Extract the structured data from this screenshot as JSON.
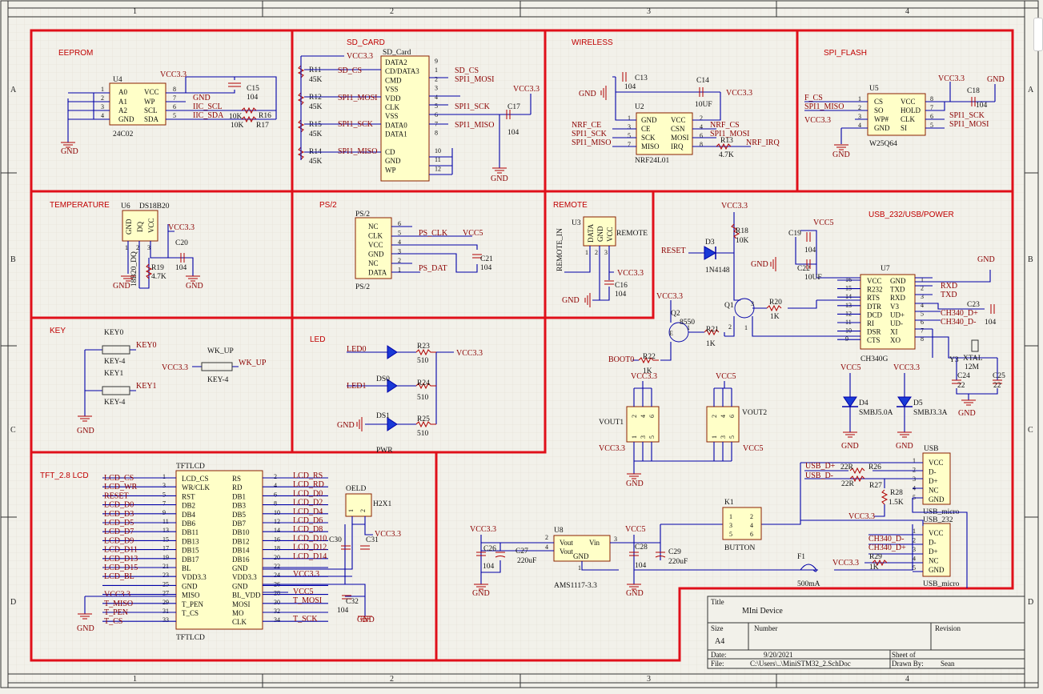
{
  "zones": {
    "columns": [
      "1",
      "2",
      "3",
      "4"
    ],
    "rows": [
      "A",
      "B",
      "C",
      "D"
    ]
  },
  "sections": [
    "EEPROM",
    "SD_CARD",
    "WIRELESS",
    "SPI_FLASH",
    "TEMPERATURE",
    "PS/2",
    "REMOTE",
    "USB_232/USB/POWER",
    "KEY",
    "LED",
    "TFT_2.8 LCD"
  ],
  "eeprom": {
    "ref": "U4",
    "part": "24C02",
    "left_pins": [
      "A0",
      "A1",
      "A2",
      "GND"
    ],
    "left_nums": [
      "1",
      "2",
      "3",
      "4"
    ],
    "right_pins": [
      "VCC",
      "WP",
      "SCL",
      "SDA"
    ],
    "right_nums": [
      "8",
      "7",
      "6",
      "5"
    ],
    "nets": {
      "vcc": "VCC3.3",
      "gnd_wp": "GND",
      "scl": "IIC_SCL",
      "sda": "IIC_SDA",
      "gnd": "GND"
    },
    "c15": {
      "ref": "C15",
      "val": "104"
    },
    "r16": {
      "ref": "R16",
      "val": "10K"
    },
    "r17": {
      "ref": "R17",
      "val": "10K"
    }
  },
  "sdcard": {
    "ref": "SD_Card",
    "pins": [
      "DATA2",
      "CD/DATA3",
      "CMD",
      "VSS",
      "VDD",
      "CLK",
      "VSS",
      "DATA0",
      "DATA1",
      "",
      "CD",
      "GND",
      "WP"
    ],
    "nums": [
      "9",
      "1",
      "2",
      "3",
      "4",
      "5",
      "6",
      "7",
      "8",
      "",
      "10",
      "11",
      "12"
    ],
    "nets": {
      "vcc": "VCC3.3",
      "cs": "SD_CS",
      "mosi": "SPI1_MOSI",
      "sck": "SPI1_SCK",
      "miso": "SPI1_MISO",
      "gnd": "GND"
    },
    "left_nets": [
      "SD_CS",
      "SPI1_MOSI",
      "SPI1_SCK",
      "SPI1_MISO"
    ],
    "resistors": [
      {
        "ref": "R11",
        "val": "45K"
      },
      {
        "ref": "R12",
        "val": "45K"
      },
      {
        "ref": "R15",
        "val": "45K"
      },
      {
        "ref": "R14",
        "val": "45K"
      }
    ],
    "c17": {
      "ref": "C17",
      "val": "104"
    }
  },
  "wireless": {
    "ref": "U2",
    "part": "NRF24L01",
    "left_pins": [
      "GND",
      "CE",
      "SCK",
      "MISO"
    ],
    "left_nums": [
      "1",
      "3",
      "5",
      "7"
    ],
    "right_pins": [
      "VCC",
      "CSN",
      "MOSI",
      "IRQ"
    ],
    "right_nums": [
      "2",
      "4",
      "6",
      "8"
    ],
    "left_nets": [
      "NRF_CE",
      "SPI1_SCK",
      "SPI1_MISO"
    ],
    "right_nets": [
      "NRF_CS",
      "SPI1_MOSI",
      "NRF_IRQ"
    ],
    "gnd": "GND",
    "vcc": "VCC3.3",
    "c13": {
      "ref": "C13",
      "val": "104"
    },
    "c14": {
      "ref": "C14",
      "val": "10UF"
    },
    "r13": {
      "ref": "R13",
      "val": "4.7K"
    }
  },
  "spiflash": {
    "ref": "U5",
    "part": "W25Q64",
    "left_pins": [
      "CS",
      "SO",
      "WP#",
      "GND"
    ],
    "left_nums": [
      "1",
      "2",
      "3",
      "4"
    ],
    "right_pins": [
      "VCC",
      "HOLD",
      "CLK",
      "SI"
    ],
    "right_nums": [
      "8",
      "7",
      "6",
      "5"
    ],
    "left_nets": [
      "F_CS",
      "SPI1_MISO",
      "VCC3.3"
    ],
    "right_nets": [
      "SPI1_SCK",
      "SPI1_MOSI"
    ],
    "vcc": "VCC3.3",
    "gnd": "GND",
    "c18": {
      "ref": "C18",
      "val": "104"
    }
  },
  "temperature": {
    "ref": "U6",
    "part": "DS18B20",
    "pins": [
      "GND",
      "DQ",
      "VCC"
    ],
    "nums": [
      "1",
      "2",
      "3"
    ],
    "net": "18B20_DQ",
    "vcc": "VCC3.3",
    "gnd": "GND",
    "r19": {
      "ref": "R19",
      "val": "4.7K"
    },
    "c20": {
      "ref": "C20",
      "val": "104"
    }
  },
  "ps2": {
    "ref": "PS/2",
    "pins": [
      "NC",
      "CLK",
      "VCC",
      "GND",
      "NC",
      "DATA"
    ],
    "nums": [
      "6",
      "5",
      "4",
      "3",
      "2",
      "1"
    ],
    "nets": {
      "clk": "PS_CLK",
      "dat": "PS_DAT",
      "vcc": "VCC5"
    },
    "c21": {
      "ref": "C21",
      "val": "104"
    },
    "bottom_label": "PS/2"
  },
  "remote": {
    "ref": "U3",
    "pins": [
      "DATA",
      "GND",
      "VCC"
    ],
    "nums": [
      "1",
      "2",
      "3"
    ],
    "part": "REMOTE",
    "net": "REMOTE_IN",
    "vcc": "VCC3.3",
    "gnd": "GND",
    "c16": {
      "ref": "C16",
      "val": "104"
    }
  },
  "usb": {
    "ref": "U7",
    "part": "CH340G",
    "left_pins": [
      "VCC",
      "R232",
      "RTS",
      "DTR",
      "DCD",
      "RI",
      "DSR",
      "CTS"
    ],
    "left_nums": [
      "16",
      "15",
      "14",
      "13",
      "12",
      "11",
      "10",
      "9"
    ],
    "right_pins": [
      "GND",
      "TXD",
      "RXD",
      "V3",
      "UD+",
      "UD-",
      "XI",
      "XO"
    ],
    "right_nums": [
      "1",
      "2",
      "3",
      "4",
      "5",
      "6",
      "7",
      "8"
    ],
    "right_nets": [
      "RXD",
      "TXD",
      "CH340_D+",
      "CH340_D-"
    ],
    "nets": {
      "reset": "RESET",
      "boot": "BOOT0",
      "vcc33": "VCC3.3",
      "vcc5": "VCC5",
      "gnd": "GND"
    },
    "d3": {
      "ref": "D3",
      "val": "1N4148"
    },
    "r18": {
      "ref": "R18",
      "val": "10K"
    },
    "c19": {
      "ref": "C19",
      "val": "104"
    },
    "c22": {
      "ref": "C22",
      "val": "10UF"
    },
    "q1": {
      "ref": "Q1",
      "pins": [
        "1",
        "2",
        "3"
      ]
    },
    "q2": {
      "ref": "Q2",
      "val": "8550",
      "pins": [
        "1",
        "2",
        "3"
      ],
      "e": "E"
    },
    "r20": {
      "ref": "R20",
      "val": "1K"
    },
    "r21": {
      "ref": "R21",
      "val": "1K"
    },
    "r22": {
      "ref": "R22",
      "val": "1K"
    },
    "c23": {
      "ref": "C23",
      "val": "104"
    },
    "y3": {
      "ref": "Y3",
      "part": "XTAL",
      "val": "12M"
    },
    "c24": {
      "ref": "C24",
      "val": "22"
    },
    "c25": {
      "ref": "C25",
      "val": "22"
    },
    "d4": {
      "ref": "D4",
      "val": "SMBJ5.0A"
    },
    "d5": {
      "ref": "D5",
      "val": "SMBJ3.3A"
    },
    "vout1": {
      "ref": "VOUT1",
      "top": "VCC3.3",
      "bottom": "VCC3.3",
      "pins": [
        "2",
        "4",
        "6",
        "1",
        "3",
        "5"
      ]
    },
    "vout2": {
      "ref": "VOUT2",
      "top": "VCC5",
      "bottom": "VCC5",
      "pins": [
        "2",
        "4",
        "6",
        "1",
        "3",
        "5"
      ]
    },
    "u8": {
      "ref": "U8",
      "part": "AMS1117-3.3",
      "pins": [
        "Vout",
        "Vout",
        "GND",
        "Vin"
      ],
      "nums": [
        "2",
        "4",
        "1",
        "3"
      ]
    },
    "c26": {
      "ref": "C26",
      "val": "104"
    },
    "c27": {
      "ref": "C27",
      "val": "220uF"
    },
    "c28": {
      "ref": "C28",
      "val": "104"
    },
    "c29": {
      "ref": "C29",
      "val": "220uF"
    },
    "k1": {
      "ref": "K1",
      "part": "BUTTON",
      "nums": [
        "1",
        "3",
        "5",
        "2",
        "4",
        "6"
      ]
    },
    "f1": {
      "ref": "F1",
      "val": "500mA"
    },
    "usb_micro": {
      "ref": "USB",
      "part": "USB_micro",
      "pins": [
        "VCC",
        "D-",
        "D+",
        "NC",
        "GND"
      ],
      "nums": [
        "1",
        "2",
        "3",
        "4",
        "5"
      ]
    },
    "usb_232": {
      "ref": "USB_232",
      "part": "USB_micro",
      "pins": [
        "VCC",
        "D-",
        "D+",
        "NC",
        "GND"
      ],
      "nums": [
        "1",
        "2",
        "3",
        "4",
        "5"
      ]
    },
    "usb_nets": [
      "USB_D+",
      "USB_D-",
      "CH340_D-",
      "CH340_D+"
    ],
    "r26": {
      "ref": "R26",
      "val": "22R"
    },
    "r27": {
      "ref": "R27",
      "val": "22R"
    },
    "r28": {
      "ref": "R28",
      "val": "1.5K"
    },
    "r29": {
      "ref": "R29",
      "val": "1K"
    }
  },
  "key": {
    "key0": {
      "ref": "KEY0",
      "part": "KEY-4",
      "net": "KEY0"
    },
    "key1": {
      "ref": "KEY1",
      "part": "KEY-4",
      "net": "KEY1"
    },
    "wkup": {
      "ref": "WK_UP",
      "part": "KEY-4",
      "net": "WK_UP",
      "vcc": "VCC3.3"
    },
    "gnd": "GND"
  },
  "led": {
    "nets": [
      "LED0",
      "LED1"
    ],
    "rows": [
      {
        "ref": "DS0",
        "r": "R23",
        "val": "510"
      },
      {
        "ref": "DS1",
        "r": "R24",
        "val": "510"
      },
      {
        "ref": "PWR",
        "r": "R25",
        "val": "510"
      }
    ],
    "vcc": "VCC3.3",
    "gnd": "GND"
  },
  "tft": {
    "ref": "TFTLCD",
    "left_pins": [
      "LCD_CS",
      "WR/CLK",
      "RST",
      "DB2",
      "DB4",
      "DB6",
      "DB11",
      "DB13",
      "DB15",
      "DB17",
      "BL",
      "VDD3.3",
      "GND",
      "MISO",
      "T_PEN",
      "T_CS"
    ],
    "left_nums": [
      "1",
      "3",
      "5",
      "7",
      "9",
      "11",
      "13",
      "15",
      "17",
      "19",
      "21",
      "23",
      "25",
      "27",
      "29",
      "31",
      "33"
    ],
    "right_pins": [
      "RS",
      "RD",
      "DB1",
      "DB3",
      "DB5",
      "DB7",
      "DB10",
      "DB12",
      "DB14",
      "DB16",
      "GND",
      "VDD3.3",
      "GND",
      "BL_VDD",
      "MOSI",
      "MO",
      "CLK"
    ],
    "right_nums": [
      "2",
      "4",
      "6",
      "8",
      "10",
      "12",
      "14",
      "16",
      "18",
      "20",
      "22",
      "24",
      "26",
      "28",
      "30",
      "32",
      "34"
    ],
    "left_nets": [
      "LCD_CS",
      "LCD_WR",
      "RESET",
      "LCD_D0",
      "LCD_D3",
      "LCD_D5",
      "LCD_D7",
      "LCD_D9",
      "LCD_D11",
      "LCD_D13",
      "LCD_D15",
      "LCD_BL",
      "VCC3.3",
      "T_MISO",
      "T_PEN",
      "T_CS"
    ],
    "right_nets": [
      "LCD_RS",
      "LCD_RD",
      "LCD_D0",
      "LCD_D2",
      "LCD_D4",
      "LCD_D6",
      "LCD_D8",
      "LCD_D10",
      "LCD_D12",
      "LCD_D14",
      "VCC3.3",
      "VCC5",
      "T_MOSI",
      "T_SCK"
    ],
    "gnd": "GND",
    "oeld": {
      "ref": "OELD",
      "part": "H2X1",
      "pins": [
        "1",
        "2"
      ]
    },
    "c30": {
      "ref": "C30"
    },
    "c31": {
      "ref": "C31"
    },
    "c32": {
      "ref": "C32",
      "val": "104"
    },
    "vcc": "VCC3.3"
  },
  "title_block": {
    "title_label": "Title",
    "title": "MIni Device",
    "size_label": "Size",
    "size": "A4",
    "number_label": "Number",
    "revision_label": "Revision",
    "date_label": "Date:",
    "date": "9/20/2021",
    "file_label": "File:",
    "file": "C:\\Users\\..\\MiniSTM32_2.SchDoc",
    "sheet_label": "Sheet   of",
    "drawn_label": "Drawn By:",
    "drawn": "Sean"
  },
  "colors": {
    "section_border": "#e0101a",
    "wire": "#0000a8",
    "net_label": "#8b0000",
    "component_fill": "#ffffc8",
    "background": "#f2f1ea"
  }
}
